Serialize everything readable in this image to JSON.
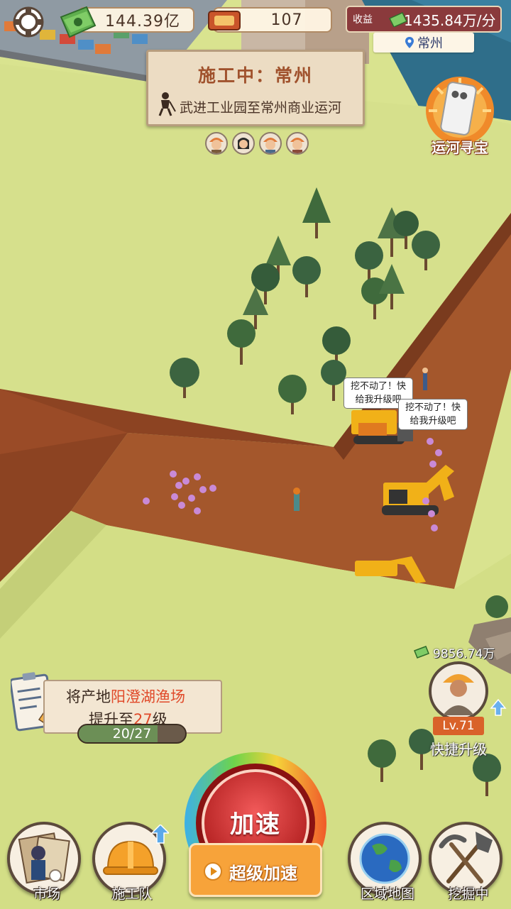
{
  "hud": {
    "money": "144.39亿",
    "tickets": "107",
    "income_label": "收益",
    "income_value": "1435.84万/分",
    "city": "常州"
  },
  "banner": {
    "title": "施工中：常州",
    "route": "武进工业园至常州商业运河"
  },
  "treasure": {
    "label": "运河寻宝"
  },
  "bubbles": [
    {
      "text": "挖不动了！快给我升级吧"
    },
    {
      "text": "挖不动了！快给我升级吧"
    }
  ],
  "task": {
    "line1_prefix": "将产地",
    "line1_place": "阳澄湖渔场",
    "line2_prefix": "提升至",
    "line2_level": "27",
    "line2_suffix": "级",
    "progress_text": "20/27",
    "progress_current": 20,
    "progress_total": 27
  },
  "quick_upgrade": {
    "cost": "9856.74万",
    "level": "Lv.71",
    "label": "快捷升级"
  },
  "bottom": {
    "market": "市场",
    "crew": "施工队",
    "speed": "加速",
    "super_speed": "超级加速",
    "region_map": "区域地图",
    "digging": "挖掘中"
  },
  "colors": {
    "grass": "#d9e38f",
    "soil": "#a4572c",
    "income_bg": "#8a3a3c",
    "super_btn": "#f7a33a",
    "highlight": "#e04a2a"
  }
}
